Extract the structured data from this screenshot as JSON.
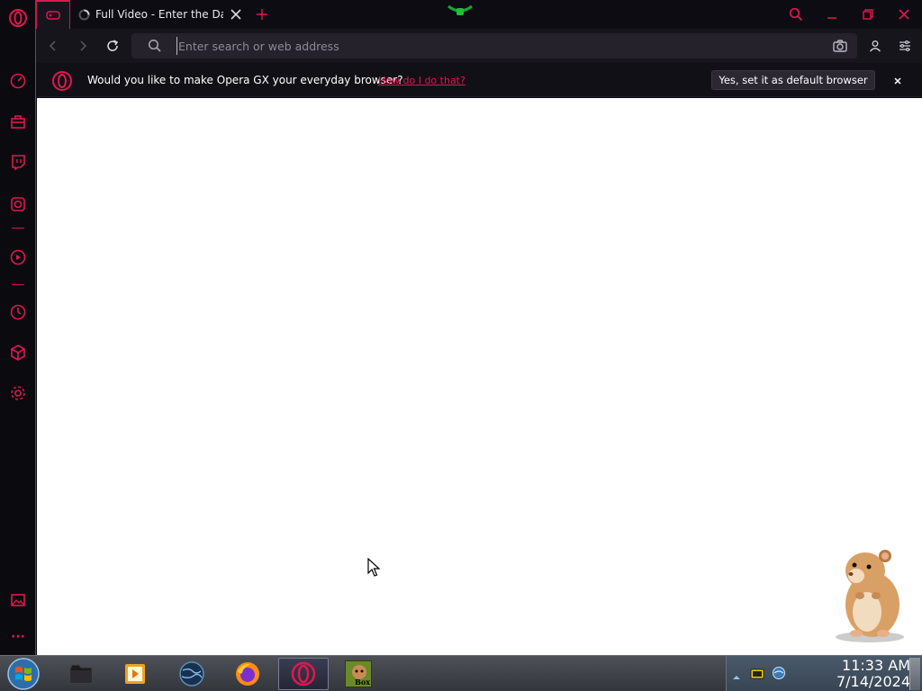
{
  "tabs": {
    "active_title": "Full Video - Enter the Dang",
    "new_tab_label": "+"
  },
  "address_bar": {
    "placeholder": "Enter search or web address",
    "value": ""
  },
  "infobar": {
    "message": "Would you like to make Opera GX your everyday browser?",
    "link": "How do I do that?",
    "button": "Yes, set it as default browser"
  },
  "sidebar": {
    "items": [
      "opera-menu",
      "speed-dial",
      "gx-store",
      "twitch",
      "instagram",
      "youtube",
      "history",
      "extensions",
      "settings",
      "pinboard",
      "more"
    ],
    "more_label": "···"
  },
  "taskbar": {
    "apps": [
      "start",
      "file-manager",
      "media-player",
      "browser-globe",
      "firefox",
      "opera-gx",
      "bonzi-box"
    ],
    "box_label": "Box",
    "clock_time": "11:33 AM",
    "clock_date": "7/14/2024"
  },
  "colors": {
    "accent": "#e0174f",
    "chrome_bg": "#0c0b10",
    "content_bg": "#ffffff"
  }
}
